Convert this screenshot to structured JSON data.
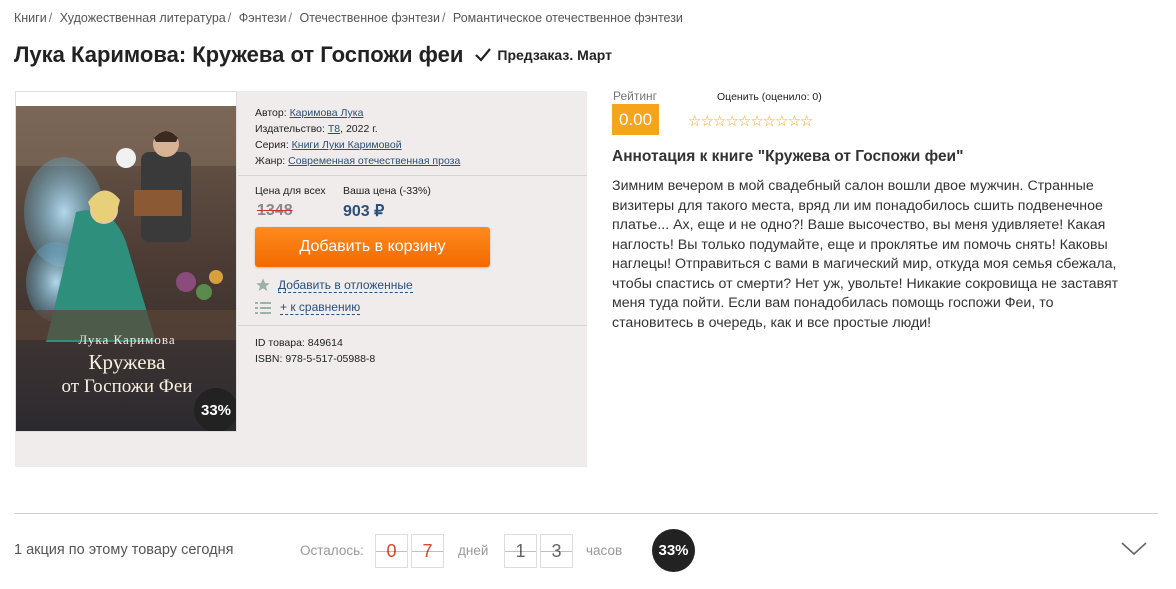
{
  "breadcrumb": [
    "Книги",
    "Художественная литература",
    "Фэнтези",
    "Отечественное фэнтези",
    "Романтическое отечественное фэнтези"
  ],
  "breadcrumb_sep": "/",
  "product": {
    "title": "Лука Каримова: Кружева от Госпожи феи",
    "status": "Предзаказ. Март"
  },
  "cover": {
    "author": "Лука Каримова",
    "title_line1": "Кружева",
    "title_line2": "от Госпожи Феи",
    "badge": "33%"
  },
  "meta": {
    "author_label": "Автор:",
    "author": "Каримова Лука",
    "publisher_label": "Издательство:",
    "publisher": "Т8",
    "year": ", 2022 г.",
    "series_label": "Серия:",
    "series": "Книги Луки Каримовой",
    "genre_label": "Жанр:",
    "genre": "Современная отечественная проза"
  },
  "price": {
    "all_label": "Цена для всех",
    "old": "1348",
    "your_label": "Ваша цена (-33%)",
    "new": "903 ₽"
  },
  "actions": {
    "cart": "Добавить в корзину",
    "defer": "Добавить в отложенные",
    "compare": "+ к сравнению"
  },
  "ids": {
    "id_line": "ID товара: 849614",
    "isbn_line": "ISBN: 978-5-517-05988-8"
  },
  "rating": {
    "label": "Рейтинг",
    "value": "0.00",
    "rate_label": "Оценить (оценило: 0)",
    "stars": "☆☆☆☆☆☆☆☆☆☆"
  },
  "annotation": {
    "title": "Аннотация к книге \"Кружева от Госпожи феи\"",
    "text": "Зимним вечером в мой свадебный салон вошли двое мужчин. Странные визитеры для такого места, вряд ли им понадобилось сшить подвенечное платье... Ах, еще и не одно?! Ваше высочество, вы меня удивляете! Какая наглость! Вы только подумайте, еще и проклятье им помочь снять! Каковы наглецы! Отправиться с вами в магический мир, откуда моя семья сбежала, чтобы спастись от смерти? Нет уж, увольте! Никакие сокровища не заставят меня туда пойти. Если вам понадобилась помощь госпожи Феи, то становитесь в очередь, как и все простые люди!"
  },
  "promo": {
    "text": "1 акция по этому товару сегодня",
    "left_label": "Осталось:",
    "days": [
      "0",
      "7"
    ],
    "days_label": "дней",
    "hours": [
      "1",
      "3"
    ],
    "hours_label": "часов",
    "badge": "33%"
  },
  "colors": {
    "accent": "#f26a00",
    "link": "#2b4f7c",
    "rating": "#f4a51c"
  }
}
